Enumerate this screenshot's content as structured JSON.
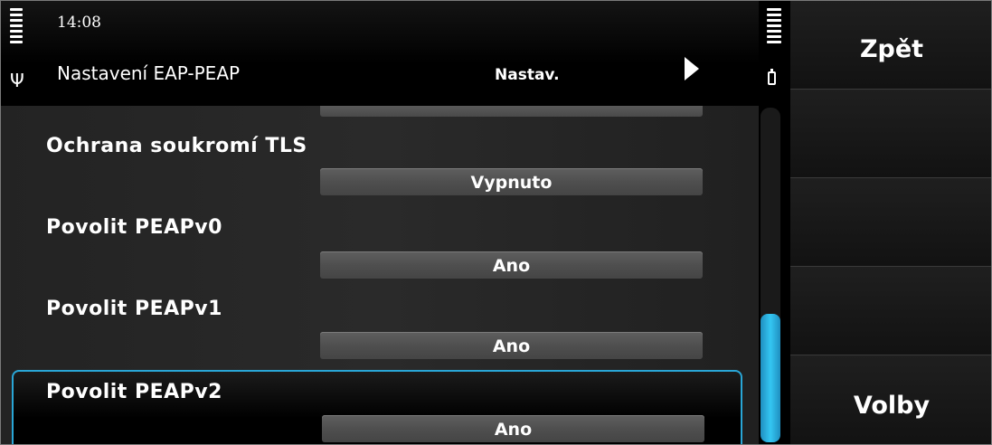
{
  "status": {
    "time": "14:08"
  },
  "header": {
    "title": "Nastavení EAP-PEAP",
    "tab_label": "Nastav."
  },
  "settings": [
    {
      "label": "Ochrana soukromí TLS",
      "value": "Vypnuto"
    },
    {
      "label": "Povolit PEAPv0",
      "value": "Ano"
    },
    {
      "label": "Povolit PEAPv1",
      "value": "Ano"
    },
    {
      "label": "Povolit PEAPv2",
      "value": "Ano"
    }
  ],
  "softkeys": {
    "back": "Zpět",
    "options": "Volby"
  },
  "colors": {
    "accent": "#29a6d6",
    "background": "#000000"
  }
}
